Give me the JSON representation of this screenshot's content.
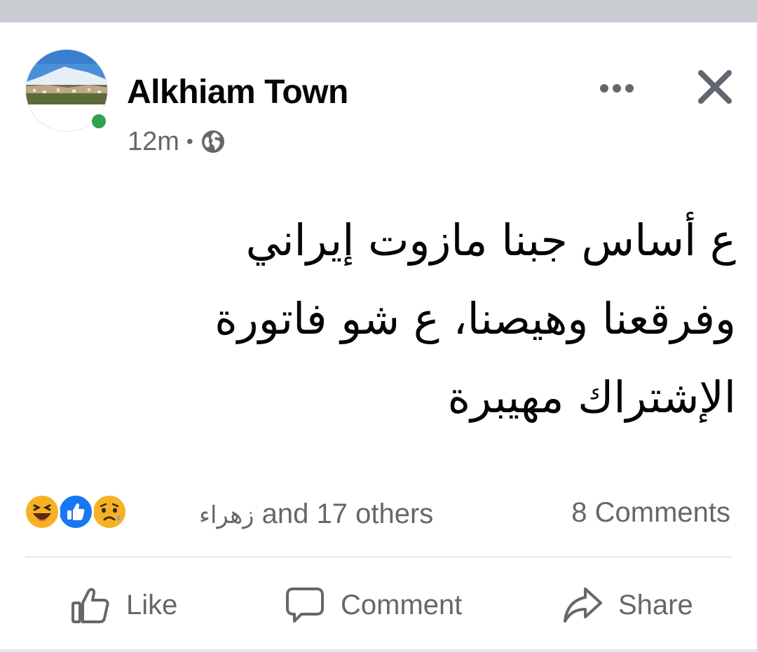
{
  "post": {
    "page_name": "Alkhiam Town",
    "timestamp": "12m",
    "separator": "•",
    "privacy_icon": "globe-icon",
    "text_lines": [
      "ع أساس جبنا مازوت إيراني",
      "وفرقعنا وهيصنا، ع شو فاتورة",
      "الإشتراك مهيبرة"
    ]
  },
  "engagement": {
    "reaction_icons": [
      "haha-icon",
      "like-icon",
      "sad-icon"
    ],
    "reactor_name": "زهراء",
    "reactor_suffix": " and 17 others",
    "comments_label": "8 Comments"
  },
  "actions": {
    "like_label": "Like",
    "comment_label": "Comment",
    "share_label": "Share"
  },
  "colors": {
    "online": "#31a24c",
    "secondary_text": "#65676b",
    "like_blue": "#1877f2",
    "reaction_yellow": "#f7b125"
  }
}
